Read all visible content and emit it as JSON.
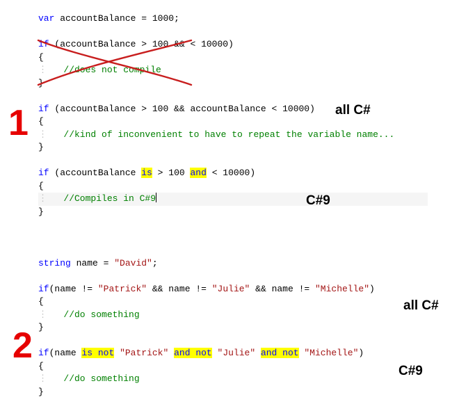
{
  "example1": {
    "decl_kw": "var",
    "decl_name": "accountBalance",
    "decl_assign": " = ",
    "decl_val": "1000",
    "semi": ";",
    "bad": {
      "if_kw": "if",
      "open": " (",
      "name": "accountBalance",
      "gt": " > ",
      "v1": "100",
      "amp": " && ",
      "lt": "< ",
      "v2": "10000",
      "close": ")",
      "lbr": "{",
      "cmt": "//does not compile",
      "rbr": "}"
    },
    "ok": {
      "if_kw": "if",
      "open": " (",
      "name1": "accountBalance",
      "gt": " > ",
      "v1": "100",
      "amp": " && ",
      "name2": "accountBalance",
      "lt": " < ",
      "v2": "10000",
      "close": ")",
      "lbr": "{",
      "cmt": "//kind of inconvenient to have to repeat the variable name...",
      "rbr": "}"
    },
    "pat": {
      "if_kw": "if",
      "open": " (",
      "name": "accountBalance",
      "sp1": " ",
      "is_kw": "is",
      "gt": " > ",
      "v1": "100",
      "sp2": " ",
      "and_kw": "and",
      "lt": " < ",
      "v2": "10000",
      "close": ")",
      "lbr": "{",
      "cmt": "//Compiles in C#9",
      "rbr": "}"
    }
  },
  "example2": {
    "decl_kw": "string",
    "decl_name": "name",
    "decl_assign": " = ",
    "decl_val": "\"David\"",
    "semi": ";",
    "old": {
      "if_kw": "if",
      "open": "(",
      "name1": "name",
      "ne": " != ",
      "s1": "\"Patrick\"",
      "amp": " && ",
      "name2": "name",
      "s2": "\"Julie\"",
      "name3": "name",
      "s3": "\"Michelle\"",
      "close": ")",
      "lbr": "{",
      "cmt": "//do something",
      "rbr": "}"
    },
    "pat": {
      "if_kw": "if",
      "open": "(",
      "name": "name",
      "sp": " ",
      "isnot": "is not",
      "sp2": " ",
      "s1": "\"Patrick\"",
      "andnot": "and not",
      "s2": "\"Julie\"",
      "s3": "\"Michelle\"",
      "close": ")",
      "lbr": "{",
      "cmt": "//do something",
      "rbr": "}"
    }
  },
  "annotations": {
    "all_cs_1": "all C#",
    "cs9_1": "C#9",
    "all_cs_2": "all C#",
    "cs9_2": "C#9",
    "num1": "1",
    "num2": "2"
  },
  "guide": "⋮   "
}
